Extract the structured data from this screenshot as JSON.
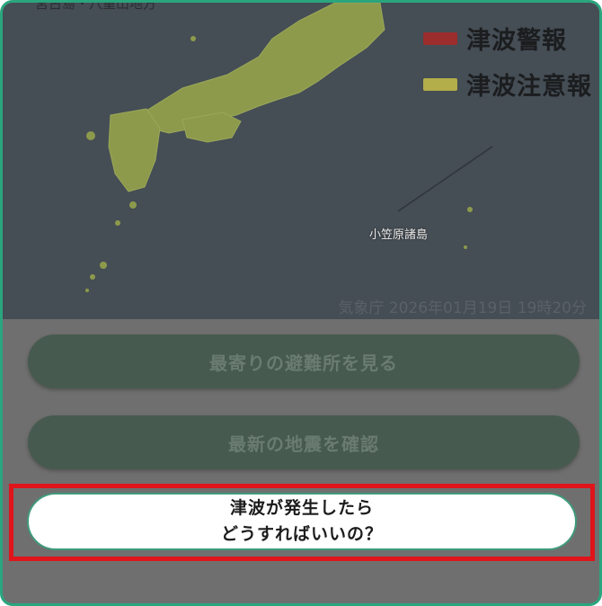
{
  "map": {
    "region_label_top": "宮古島・八重山地方",
    "legend": [
      {
        "label": "津波警報",
        "color": "#9b2d2d"
      },
      {
        "label": "津波注意報",
        "color": "#b3ad4a"
      }
    ],
    "island_label": "小笠原諸島",
    "source_timestamp": "気象庁 2026年01月19日 19時20分",
    "land_color": "#8d9a4b",
    "sea_color": "#454d55"
  },
  "buttons": {
    "nearest_shelter": "最寄りの避難所を見る",
    "latest_earthquake": "最新の地震を確認",
    "tsunami_help_line1": "津波が発生したら",
    "tsunami_help_line2": "どうすればいいの？"
  },
  "colors": {
    "frame_border": "#2aa57e",
    "highlight_border": "#e0141b",
    "button_bg": "#475a4f"
  }
}
